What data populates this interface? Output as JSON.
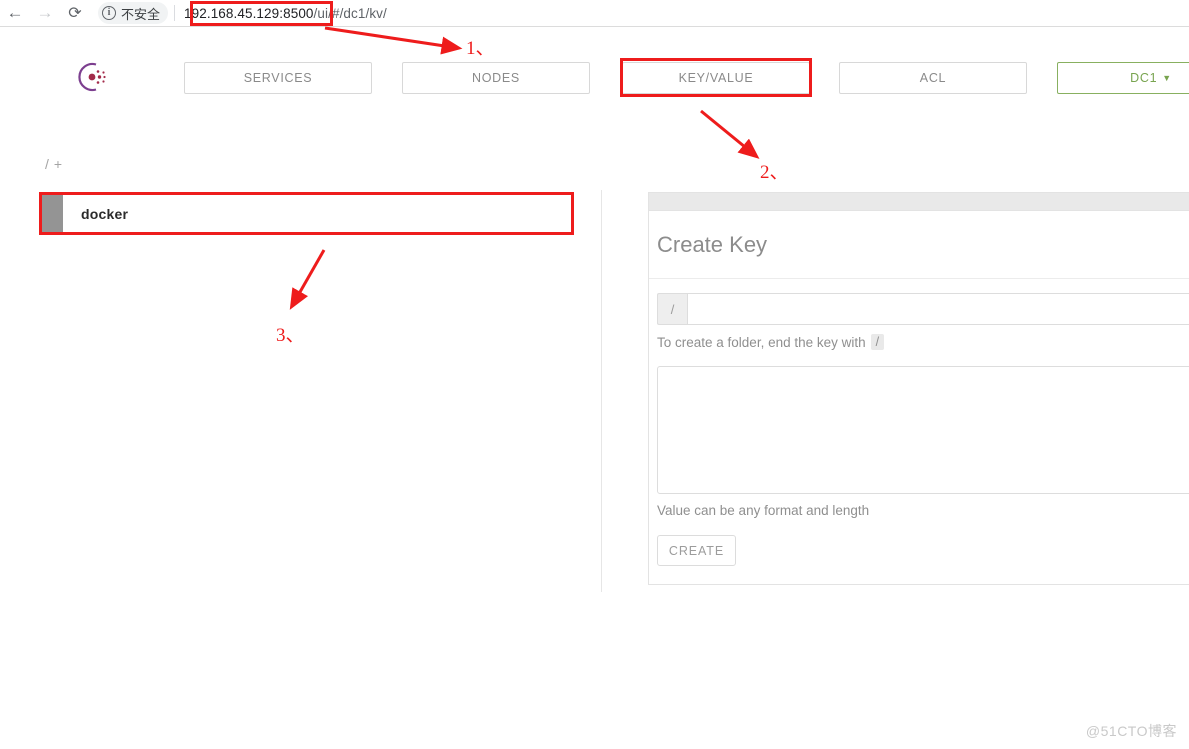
{
  "browser": {
    "back_icon": "back-arrow-icon",
    "forward_icon": "forward-arrow-icon",
    "reload_icon": "reload-icon",
    "info_icon": "info-circle-icon",
    "info_glyph": "i",
    "security_text": "不安全",
    "url_host": "192.168.45.129:8500",
    "url_path": "/ui/#/dc1/kv/"
  },
  "app": {
    "logo_name": "consul-logo",
    "tabs": [
      {
        "label": "SERVICES",
        "name": "tab-services"
      },
      {
        "label": "NODES",
        "name": "tab-nodes"
      },
      {
        "label": "KEY/VALUE",
        "name": "tab-key-value"
      },
      {
        "label": "ACL",
        "name": "tab-acl"
      }
    ],
    "datacenter": {
      "label": "DC1",
      "caret": "▼",
      "border_color": "#88b060",
      "text_color": "#78a44f"
    }
  },
  "kv": {
    "breadcrumb_root": "/",
    "breadcrumb_add": "+",
    "items": [
      {
        "label": "docker"
      }
    ]
  },
  "create_key": {
    "title": "Create Key",
    "key_prefix": "/",
    "key_value": "",
    "key_placeholder": "",
    "key_help_text": "To create a folder, end the key with",
    "key_help_code": "/",
    "value_text": "",
    "value_placeholder": "",
    "value_help_text": "Value can be any format and length",
    "create_label": "CREATE"
  },
  "annotations": {
    "color": "#ee1c1c",
    "markers": [
      {
        "id": "1",
        "label": "1、",
        "target": "url-host-box"
      },
      {
        "id": "2",
        "label": "2、",
        "target": "key-value-tab-box"
      },
      {
        "id": "3",
        "label": "3、",
        "target": "docker-row-box"
      }
    ]
  },
  "watermark": {
    "text": "@51CTO博客"
  }
}
